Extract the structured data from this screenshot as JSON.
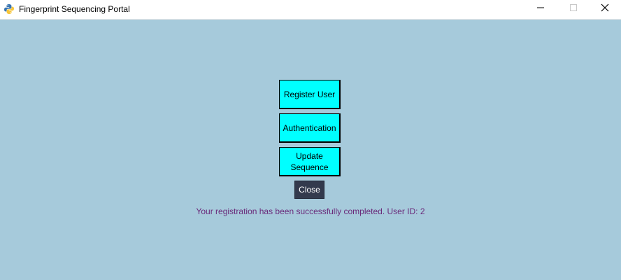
{
  "window": {
    "title": "Fingerprint Sequencing Portal",
    "app_icon": "python-icon",
    "controls": {
      "minimize_icon": "minimize-icon",
      "maximize_icon": "maximize-icon",
      "close_icon": "close-icon"
    },
    "background_color": "#a6cadb"
  },
  "menu": {
    "register_label": "Register User",
    "auth_label": "Authentication",
    "update_label": "Update\nSequence",
    "close_label": "Close",
    "button_color": "#00ffff",
    "close_button_color": "#333a4d"
  },
  "status": {
    "message": "Your registration has been successfully completed. User ID: 2",
    "color": "#6a2a7a"
  }
}
